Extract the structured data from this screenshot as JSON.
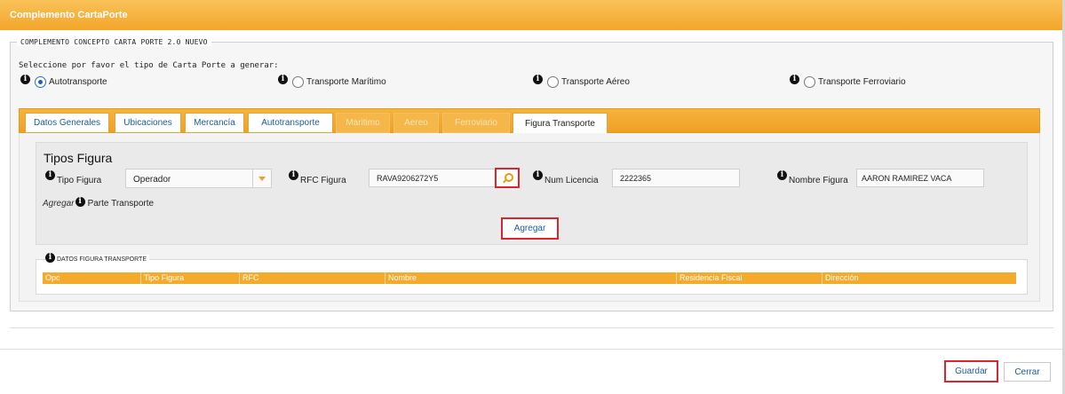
{
  "window": {
    "title": "Complemento CartaPorte"
  },
  "section": {
    "legend": "COMPLEMENTO CONCEPTO CARTA PORTE 2.0 NUEVO",
    "prompt": "Seleccione por favor el tipo de Carta Porte a generar:"
  },
  "transport_types": [
    {
      "label": "Autotransporte",
      "checked": true
    },
    {
      "label": "Transporte Marítimo",
      "checked": false
    },
    {
      "label": "Transporte Aéreo",
      "checked": false
    },
    {
      "label": "Transporte Ferroviario",
      "checked": false
    }
  ],
  "tabs": [
    {
      "label": "Datos Generales",
      "state": "enabled"
    },
    {
      "label": "Ubicaciones",
      "state": "enabled"
    },
    {
      "label": "Mercancía",
      "state": "enabled"
    },
    {
      "label": "Autotransporte",
      "state": "enabled"
    },
    {
      "label": "Maritimo",
      "state": "disabled"
    },
    {
      "label": "Aereo",
      "state": "disabled"
    },
    {
      "label": "Ferroviario",
      "state": "disabled"
    },
    {
      "label": "Figura Transporte",
      "state": "active"
    }
  ],
  "tipos_figura": {
    "title": "Tipos Figura",
    "tipo_label": "Tipo Figura",
    "tipo_value": "Operador",
    "rfc_label": "RFC Figura",
    "rfc_value": "RAVA9206272Y5",
    "licencia_label": "Num Licencia",
    "licencia_value": "2222365",
    "nombre_label": "Nombre Figura",
    "nombre_value": "AARON RAMIREZ VACA",
    "agregar_prefix": "Agregar",
    "parte_label": "Parte Transporte",
    "agregar_button": "Agregar"
  },
  "datos_figura": {
    "title": "DATOS FIGURA TRANSPORTE",
    "columns": [
      "Opc",
      "Tipo Figura",
      "RFC",
      "Nombre",
      "Residencia Fiscal",
      "Dirección"
    ]
  },
  "footer": {
    "save": "Guardar",
    "close": "Cerrar"
  },
  "colors": {
    "accent": "#f3a62a",
    "link": "#1c5b9b",
    "highlight": "#d9262e"
  },
  "icons": {
    "info": "info-icon",
    "search": "search-icon",
    "dropdown": "chevron-down-icon"
  }
}
